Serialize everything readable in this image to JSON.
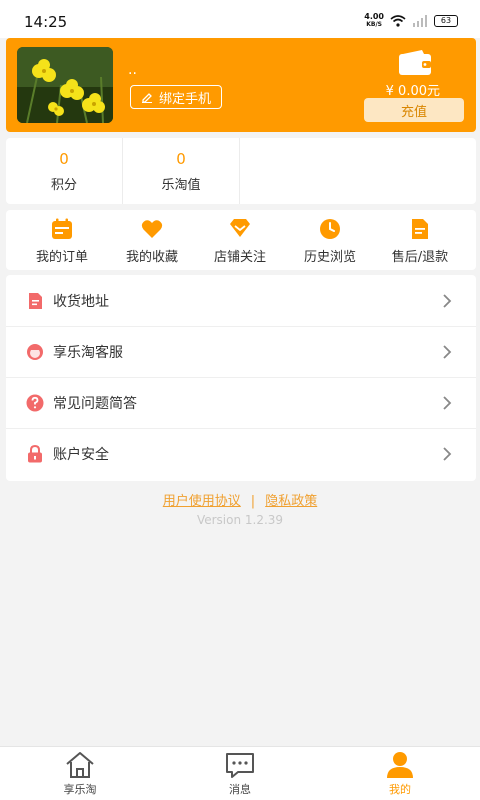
{
  "status_bar": {
    "time": "14:25",
    "net_speed_value": "4.00",
    "net_speed_unit": "KB/S",
    "battery": "63"
  },
  "profile": {
    "nickname": "..",
    "bind_phone_label": "绑定手机",
    "balance": "¥ 0.00元",
    "recharge_label": "充值"
  },
  "stats": [
    {
      "value": "0",
      "label": "积分"
    },
    {
      "value": "0",
      "label": "乐淘值"
    }
  ],
  "orders": [
    {
      "label": "我的订单",
      "icon": "calendar-icon"
    },
    {
      "label": "我的收藏",
      "icon": "heart-icon"
    },
    {
      "label": "店铺关注",
      "icon": "gem-icon"
    },
    {
      "label": "历史浏览",
      "icon": "clock-icon"
    },
    {
      "label": "售后/退款",
      "icon": "document-icon"
    }
  ],
  "menu": [
    {
      "label": "收货地址",
      "icon": "address-icon"
    },
    {
      "label": "享乐淘客服",
      "icon": "customer-service-icon"
    },
    {
      "label": "常见问题简答",
      "icon": "question-icon"
    },
    {
      "label": "账户安全",
      "icon": "lock-icon"
    }
  ],
  "links": {
    "agreement": "用户使用协议",
    "separator": "|",
    "privacy": "隐私政策"
  },
  "version": "Version 1.2.39",
  "tabs": [
    {
      "label": "享乐淘",
      "icon": "home-icon",
      "active": false
    },
    {
      "label": "消息",
      "icon": "message-icon",
      "active": false
    },
    {
      "label": "我的",
      "icon": "user-icon",
      "active": true
    }
  ],
  "colors": {
    "accent": "#ff9a00",
    "icon_red": "#f26a6a",
    "link": "#f0a030"
  }
}
